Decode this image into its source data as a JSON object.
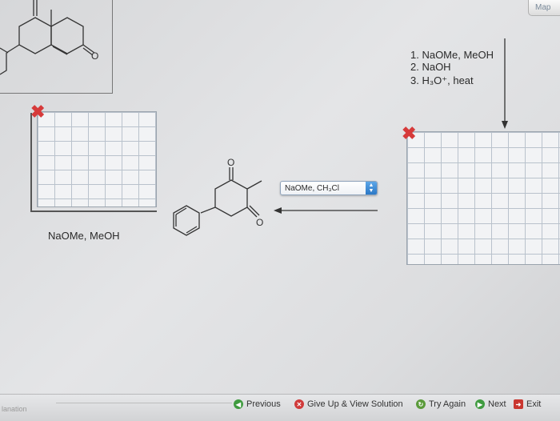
{
  "map_button": "Map",
  "reagents_top": [
    "1. NaOMe, MeOH",
    "2. NaOH",
    "3. H₃O⁺, heat"
  ],
  "reagent_left": "NaOMe, MeOH",
  "reagent_select": {
    "value": "NaOMe, CH₃Cl"
  },
  "atoms": {
    "o": "O"
  },
  "bottom": {
    "left_text": "lanation",
    "previous": "Previous",
    "give_up": "Give Up & View Solution",
    "try_again": "Try Again",
    "next": "Next",
    "exit": "Exit"
  },
  "colors": {
    "x_mark": "#d63a3a",
    "select_spin": "#2b78c6",
    "next_icon": "#3f9b3f",
    "giveup_icon": "#d03a3a"
  },
  "icons": [
    "x-mark-icon",
    "spinner-arrows-icon",
    "previous-icon",
    "give-up-icon",
    "try-again-icon",
    "next-icon",
    "exit-icon"
  ]
}
